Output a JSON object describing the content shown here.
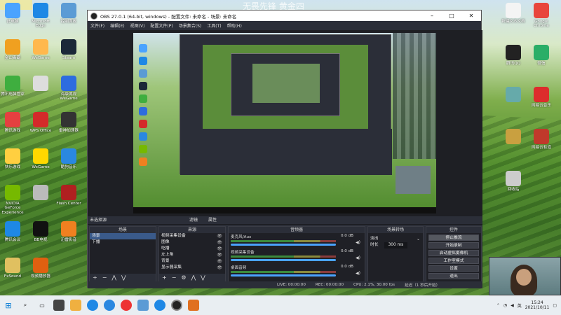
{
  "desktop": {
    "watermark": "无畏先锋 黄金四",
    "watermark_tl": "",
    "icons_left": [
      {
        "label": "此电脑",
        "color": "#4aa3ff"
      },
      {
        "label": "Microsoft Edge",
        "color": "#1e88e5"
      },
      {
        "label": "控制面板",
        "color": "#5b9bd5"
      },
      {
        "label": "金山毒霸",
        "color": "#f0a020"
      },
      {
        "label": "WeGame",
        "color": "#ffb84d"
      },
      {
        "label": "Steam",
        "color": "#1b2838"
      },
      {
        "label": "腾讯电脑管家",
        "color": "#3fae3f"
      },
      {
        "label": "",
        "color": "#ddd"
      },
      {
        "label": "海康威视 WeGame",
        "color": "#2d6cdf"
      },
      {
        "label": "腾讯游戏",
        "color": "#e54040"
      },
      {
        "label": "WPS Office",
        "color": "#d42a2a"
      },
      {
        "label": "雷神加速器",
        "color": "#333"
      },
      {
        "label": "快乐游戏",
        "color": "#ffcf40"
      },
      {
        "label": "WeGame",
        "color": "#ffd800"
      },
      {
        "label": "酷狗音乐",
        "color": "#2a88e0"
      },
      {
        "label": "NVIDIA GeForce Experience",
        "color": "#76b900"
      },
      {
        "label": "",
        "color": "#bbb"
      },
      {
        "label": "Flash Center",
        "color": "#b02020"
      },
      {
        "label": "腾讯会议",
        "color": "#1e88e5"
      },
      {
        "label": "BB电视",
        "color": "#111"
      },
      {
        "label": "迅雷影音",
        "color": "#f08020"
      },
      {
        "label": "FxSound",
        "color": "#e0c060"
      },
      {
        "label": "视频播放器",
        "color": "#e06010"
      }
    ],
    "icons_right": [
      {
        "label": "新建文本文档",
        "color": "#f4f4f4"
      },
      {
        "label": "Google Chrome",
        "color": "#e8453c"
      },
      {
        "label": "腾讯QQ",
        "color": "#222"
      },
      {
        "label": "微信",
        "color": "#2aae67"
      },
      {
        "label": "",
        "color": "#6aa"
      },
      {
        "label": "网易云音乐",
        "color": "#dd2c2c"
      },
      {
        "label": "",
        "color": "#c9a040"
      },
      {
        "label": "网易云有道",
        "color": "#c0392b"
      },
      {
        "label": "回收站",
        "color": "#ccc"
      }
    ]
  },
  "obs": {
    "title": "OBS 27.0.1 (64-bit, windows) - 配置文件: 未命名 - 场景: 未命名",
    "menu": [
      "文件(F)",
      "编辑(E)",
      "视图(V)",
      "配置文件(P)",
      "场景集合(S)",
      "工具(T)",
      "帮助(H)"
    ],
    "scene_info": "未选择源",
    "filters_label": "滤镜",
    "props_label": "属性",
    "scenes_header": "场景",
    "scenes": [
      "场景",
      "下播"
    ],
    "sources_header": "来源",
    "sources": [
      "视频采集设备",
      "图像",
      "吃播",
      "左上角",
      "背景",
      "显示器采集"
    ],
    "mixer_header": "音频器",
    "mixer": [
      {
        "name": "麦克风/Aux",
        "db": "0.0 dB"
      },
      {
        "name": "视频采集设备",
        "db": "0.0 dB"
      },
      {
        "name": "桌面音频",
        "db": "0.0 dB"
      }
    ],
    "transitions_header": "场景转场",
    "transition_type": "淡出",
    "duration_label": "时长",
    "duration_value": "300 ms",
    "controls_header": "控件",
    "controls": [
      "停止推流",
      "开始录制",
      "启动虚拟摄像机",
      "工作室模式",
      "设置",
      "退出"
    ],
    "status": {
      "live": "LIVE: 00:00:00",
      "rec": "REC: 00:00:00",
      "cpu": "CPU: 2.1%, 30.00 fps",
      "extra": "延迟（1 秒后开始）"
    }
  },
  "taskbar": {
    "time": "15:24",
    "date": "2021/10/11",
    "lang": "英"
  }
}
